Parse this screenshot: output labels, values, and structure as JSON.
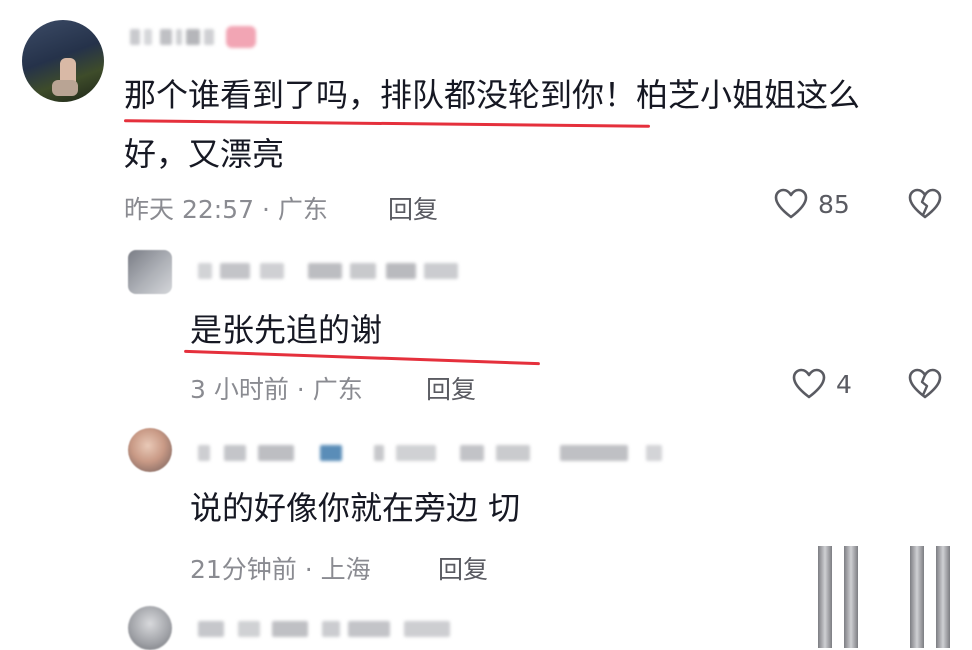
{
  "comments": [
    {
      "text_line1": "那个谁看到了吗，排队都没轮到你！柏芝小姐姐这么",
      "text_line2": "好，又漂亮",
      "meta": "昨天 22:57 · 广东",
      "reply_label": "回复",
      "likes": "85"
    },
    {
      "text_line1": "是张先追的谢",
      "meta": "3 小时前 · 广东",
      "reply_label": "回复",
      "likes": "4"
    },
    {
      "text_line1": "说的好像你就在旁边 切",
      "meta": "21分钟前 · 上海",
      "reply_label": "回复"
    }
  ],
  "colors": {
    "underline": "#e5303c",
    "meta": "#8a8b91",
    "text": "#161823"
  },
  "icons": [
    "heart-icon",
    "broken-heart-icon",
    "avatar"
  ]
}
